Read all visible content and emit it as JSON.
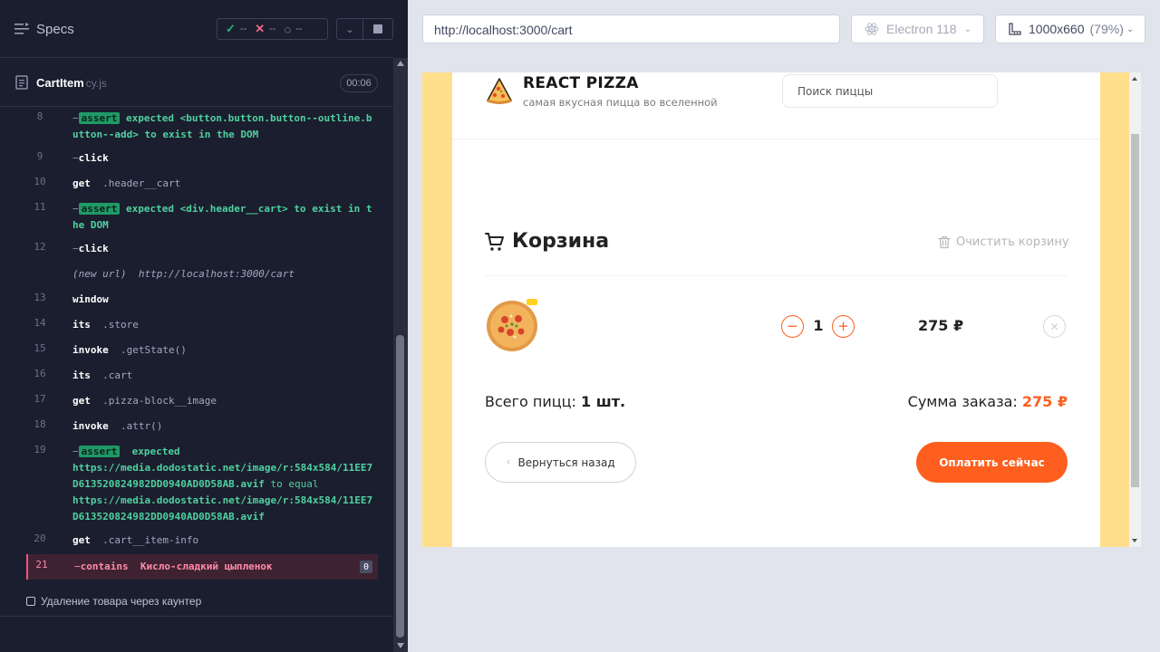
{
  "runner": {
    "specs_label": "Specs",
    "stats": {
      "passed": "--",
      "failed": "--",
      "pending": "--"
    },
    "spec_file": {
      "name": "CartItem",
      "ext": "cy.js"
    },
    "timer": "00:06",
    "commands": [
      {
        "num": "8",
        "name": "assert",
        "text": "expected <button.button.button--outline.button--add> to exist in the DOM"
      },
      {
        "num": "9",
        "name": "click"
      },
      {
        "num": "10",
        "name": "get",
        "arg": ".header__cart"
      },
      {
        "num": "11",
        "name": "assert",
        "text": "expected <div.header__cart> to exist in the DOM"
      },
      {
        "num": "12",
        "name": "click"
      },
      {
        "num": "",
        "name": "(new url)",
        "arg": "http://localhost:3000/cart"
      },
      {
        "num": "13",
        "name": "window"
      },
      {
        "num": "14",
        "name": "its",
        "arg": ".store"
      },
      {
        "num": "15",
        "name": "invoke",
        "arg": ".getState()"
      },
      {
        "num": "16",
        "name": "its",
        "arg": ".cart"
      },
      {
        "num": "17",
        "name": "get",
        "arg": ".pizza-block__image"
      },
      {
        "num": "18",
        "name": "invoke",
        "arg": ".attr()"
      },
      {
        "num": "19",
        "name": "assert",
        "expected": "expected",
        "value1": "https://media.dodostatic.net/image/r:584x584/11EE7D613520824982DD0940AD0D58AB.avif",
        "middle": "to equal",
        "value2": "https://media.dodostatic.net/image/r:584x584/11EE7D613520824982DD0940AD0D58AB.avif"
      },
      {
        "num": "20",
        "name": "get",
        "arg": ".cart__item-info"
      },
      {
        "num": "21",
        "name": "contains",
        "arg": "Кисло-сладкий цыпленок",
        "badge": "0"
      }
    ],
    "test_title": "Удаление товара через каунтер"
  },
  "browser": {
    "url": "http://localhost:3000/cart",
    "name": "Electron 118",
    "viewport": "1000x660",
    "scale": "(79%)"
  },
  "app": {
    "brand": "REACT PIZZA",
    "tagline": "самая вкусная пицца во вселенной",
    "search_placeholder": "Поиск пиццы",
    "cart_title": "Корзина",
    "clear_label": "Очистить корзину",
    "item": {
      "qty": "1",
      "price": "275 ₽",
      "minus": "−",
      "plus": "+",
      "remove": "✕"
    },
    "total_count_label": "Всего пицц:",
    "total_count_value": "1 шт.",
    "total_sum_label": "Сумма заказа:",
    "total_sum_value": "275 ₽",
    "back_label": "Вернуться назад",
    "pay_label": "Оплатить сейчас"
  },
  "colors": {
    "accent": "#fe5f1e",
    "assert_green": "#1f9a66",
    "fail": "#ff8aab",
    "runner_bg": "#1b1e2e"
  }
}
